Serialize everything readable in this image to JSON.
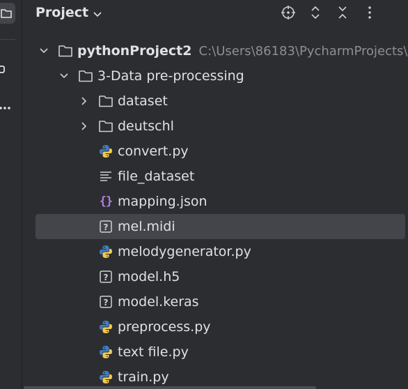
{
  "header": {
    "title": "Project",
    "tools": [
      {
        "name": "locate-icon"
      },
      {
        "name": "expand-all-icon"
      },
      {
        "name": "collapse-all-icon"
      },
      {
        "name": "more-options-icon"
      }
    ]
  },
  "tree": {
    "project": {
      "name": "pythonProject2",
      "path": "C:\\Users\\86183\\PycharmProjects\\"
    },
    "folder": {
      "name": "3-Data pre-processing"
    },
    "items": [
      {
        "name": "dataset",
        "type": "folder"
      },
      {
        "name": "deutschl",
        "type": "folder"
      },
      {
        "name": "convert.py",
        "type": "python"
      },
      {
        "name": "file_dataset",
        "type": "text"
      },
      {
        "name": "mapping.json",
        "type": "json"
      },
      {
        "name": "mel.midi",
        "type": "unknown",
        "selected": true
      },
      {
        "name": "melodygenerator.py",
        "type": "python"
      },
      {
        "name": "model.h5",
        "type": "unknown"
      },
      {
        "name": "model.keras",
        "type": "unknown"
      },
      {
        "name": "preprocess.py",
        "type": "python"
      },
      {
        "name": "text file.py",
        "type": "python"
      },
      {
        "name": "train.py",
        "type": "python"
      }
    ]
  },
  "colors": {
    "background": "#2b2d30",
    "selection": "#43454a",
    "text": "#dfe1e5",
    "path_text": "#8c8f94",
    "json_icon": "#b07fd9",
    "python_blue": "#3f7cc0",
    "python_yellow": "#f2c94c"
  }
}
